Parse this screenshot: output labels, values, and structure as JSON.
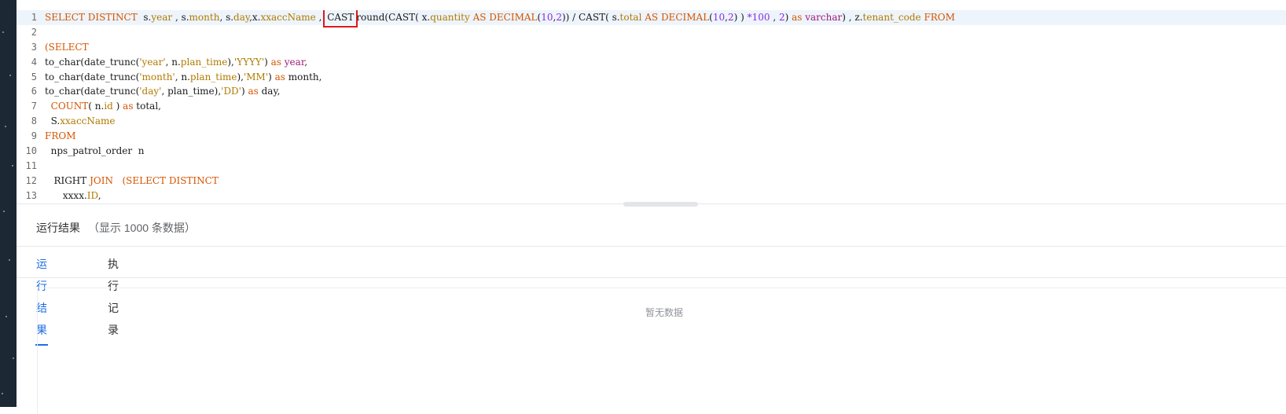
{
  "editor": {
    "lines": [
      {
        "num": "1",
        "segments": [
          {
            "c": "k",
            "t": "SELECT DISTINCT  "
          },
          {
            "c": "p",
            "t": "s."
          },
          {
            "c": "f",
            "t": "year"
          },
          {
            "c": "p",
            "t": " , s."
          },
          {
            "c": "f",
            "t": "month"
          },
          {
            "c": "p",
            "t": ", s."
          },
          {
            "c": "f",
            "t": "day"
          },
          {
            "c": "p",
            "t": ",x."
          },
          {
            "c": "f",
            "t": "xxaccName"
          },
          {
            "c": "p",
            "t": " , "
          },
          {
            "c": "hl",
            "t": "CAST"
          },
          {
            "c": "p",
            "t": "round(CAST( x."
          },
          {
            "c": "f",
            "t": "quantity"
          },
          {
            "c": "k",
            "t": " AS DECIMAL"
          },
          {
            "c": "p",
            "t": "("
          },
          {
            "c": "n",
            "t": "10"
          },
          {
            "c": "p",
            "t": ","
          },
          {
            "c": "n",
            "t": "2"
          },
          {
            "c": "p",
            "t": ")) / CAST( s."
          },
          {
            "c": "f",
            "t": "total"
          },
          {
            "c": "k",
            "t": " AS DECIMAL"
          },
          {
            "c": "p",
            "t": "("
          },
          {
            "c": "n",
            "t": "10"
          },
          {
            "c": "p",
            "t": ","
          },
          {
            "c": "n",
            "t": "2"
          },
          {
            "c": "p",
            "t": ") ) "
          },
          {
            "c": "n",
            "t": "*100"
          },
          {
            "c": "p",
            "t": " , "
          },
          {
            "c": "n",
            "t": "2"
          },
          {
            "c": "p",
            "t": ") "
          },
          {
            "c": "k",
            "t": "as"
          },
          {
            "c": "p",
            "t": " "
          },
          {
            "c": "t",
            "t": "varchar"
          },
          {
            "c": "p",
            "t": ") , z."
          },
          {
            "c": "f",
            "t": "tenant_code"
          },
          {
            "c": "k",
            "t": " FROM"
          }
        ]
      },
      {
        "num": "2",
        "segments": []
      },
      {
        "num": "3",
        "segments": [
          {
            "c": "k",
            "t": "(SELECT"
          }
        ]
      },
      {
        "num": "4",
        "segments": [
          {
            "c": "p",
            "t": "to_char(date_trunc("
          },
          {
            "c": "s",
            "t": "'year'"
          },
          {
            "c": "p",
            "t": ", n."
          },
          {
            "c": "f",
            "t": "plan_time"
          },
          {
            "c": "p",
            "t": "),"
          },
          {
            "c": "s",
            "t": "'YYYY'"
          },
          {
            "c": "p",
            "t": ") "
          },
          {
            "c": "k",
            "t": "as"
          },
          {
            "c": "p",
            "t": " "
          },
          {
            "c": "t",
            "t": "year"
          },
          {
            "c": "p",
            "t": ","
          }
        ]
      },
      {
        "num": "5",
        "segments": [
          {
            "c": "p",
            "t": "to_char(date_trunc("
          },
          {
            "c": "s",
            "t": "'month'"
          },
          {
            "c": "p",
            "t": ", n."
          },
          {
            "c": "f",
            "t": "plan_time"
          },
          {
            "c": "p",
            "t": "),"
          },
          {
            "c": "s",
            "t": "'MM'"
          },
          {
            "c": "p",
            "t": ") "
          },
          {
            "c": "k",
            "t": "as"
          },
          {
            "c": "p",
            "t": " month,"
          }
        ]
      },
      {
        "num": "6",
        "segments": [
          {
            "c": "p",
            "t": "to_char(date_trunc("
          },
          {
            "c": "s",
            "t": "'day'"
          },
          {
            "c": "p",
            "t": ", plan_time),"
          },
          {
            "c": "s",
            "t": "'DD'"
          },
          {
            "c": "p",
            "t": ") "
          },
          {
            "c": "k",
            "t": "as"
          },
          {
            "c": "p",
            "t": " day,"
          }
        ]
      },
      {
        "num": "7",
        "segments": [
          {
            "c": "p",
            "t": "  "
          },
          {
            "c": "k",
            "t": "COUNT"
          },
          {
            "c": "p",
            "t": "( n."
          },
          {
            "c": "f",
            "t": "id"
          },
          {
            "c": "p",
            "t": " ) "
          },
          {
            "c": "k",
            "t": "as"
          },
          {
            "c": "p",
            "t": " total,"
          }
        ]
      },
      {
        "num": "8",
        "segments": [
          {
            "c": "p",
            "t": "  S."
          },
          {
            "c": "f",
            "t": "xxaccName"
          }
        ]
      },
      {
        "num": "9",
        "segments": [
          {
            "c": "k",
            "t": "FROM"
          }
        ]
      },
      {
        "num": "10",
        "segments": [
          {
            "c": "p",
            "t": "  nps_patrol_order  n"
          }
        ]
      },
      {
        "num": "11",
        "segments": []
      },
      {
        "num": "12",
        "segments": [
          {
            "c": "p",
            "t": "   RIGHT "
          },
          {
            "c": "k",
            "t": "JOIN"
          },
          {
            "c": "p",
            "t": "   "
          },
          {
            "c": "k",
            "t": "(SELECT DISTINCT"
          }
        ]
      },
      {
        "num": "13",
        "segments": [
          {
            "c": "p",
            "t": "      xxxx."
          },
          {
            "c": "f",
            "t": "ID"
          },
          {
            "c": "p",
            "t": ","
          }
        ]
      }
    ]
  },
  "results": {
    "title": "运行结果",
    "subtitle": "（显示 1000 条数据）",
    "tabs": [
      {
        "label": "运行结果",
        "active": true
      },
      {
        "label": "执行记录",
        "active": false
      }
    ],
    "empty_text": "暂无数据"
  },
  "colors": {
    "accent": "#1e6fe3",
    "keyword": "#d45500",
    "highlight_box": "#e0161c"
  }
}
